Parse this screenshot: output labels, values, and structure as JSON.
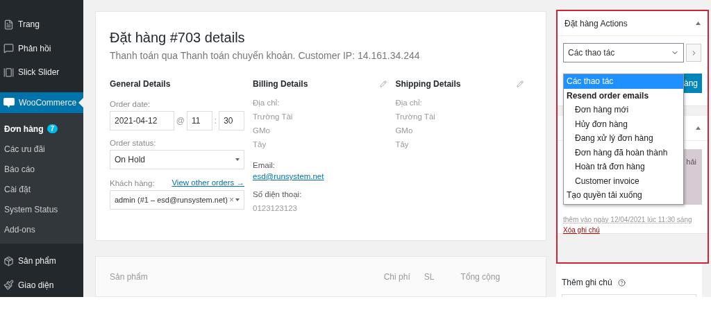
{
  "sidebar": {
    "items": [
      {
        "label": "Trang",
        "selected": false
      },
      {
        "label": "Phản hồi",
        "selected": false
      },
      {
        "label": "Slick Slider",
        "selected": false
      },
      {
        "label": "WooCommerce",
        "selected": true,
        "children": [
          {
            "label": "Đơn hàng",
            "selected": true,
            "badge": "7"
          },
          {
            "label": "Các ưu đãi",
            "selected": false
          },
          {
            "label": "Báo cáo",
            "selected": false
          },
          {
            "label": "Cài đặt",
            "selected": false
          },
          {
            "label": "System Status",
            "selected": false
          },
          {
            "label": "Add-ons",
            "selected": false
          }
        ]
      },
      {
        "label": "Sản phẩm",
        "selected": false
      },
      {
        "label": "Giao diện",
        "selected": false
      }
    ]
  },
  "order": {
    "title": "Đặt hàng #703 details",
    "subtitle": "Thanh toán qua Thanh toán chuyển khoản. Customer IP: 14.161.34.244",
    "general": {
      "heading": "General Details",
      "date_label": "Order date:",
      "date": "2021-04-12",
      "at": "@",
      "hour": "11",
      "colon": ":",
      "minute": "30",
      "status_label": "Order status:",
      "status": "On Hold",
      "customer_label": "Khách hàng:",
      "other_orders": "View other orders →",
      "customer": "admin (#1 – esd@runsystem.net)",
      "clear": "×"
    },
    "billing": {
      "heading": "Billing Details",
      "address_label": "Địa chỉ:",
      "address": [
        "Trường Tài",
        "GMo",
        "Tây"
      ],
      "email_label": "Email:",
      "email": "esd@runsystem.net",
      "phone_label": "Số điện thoại:",
      "phone": "0123123123"
    },
    "shipping": {
      "heading": "Shipping Details",
      "address_label": "Địa chỉ:",
      "address": [
        "Trường Tài",
        "GMo",
        "Tây"
      ]
    }
  },
  "items_table": {
    "columns": [
      "Sản phẩm",
      "Chi phí",
      "SL",
      "Tổng cộng"
    ]
  },
  "actions": {
    "title": "Đặt hàng Actions",
    "select": "Các thao tác",
    "button": "àng",
    "dropdown": [
      {
        "kind": "option",
        "label": "Các thao tác",
        "selected": true
      },
      {
        "kind": "group",
        "label": "Resend order emails",
        "children": [
          {
            "label": "Đơn hàng mới",
            "selected": false
          },
          {
            "label": "Hủy đơn hàng",
            "selected": false
          },
          {
            "label": "Đang xử lý đơn hàng",
            "selected": false
          },
          {
            "label": "Đơn hàng đã hoàn thành",
            "selected": false
          },
          {
            "label": "Hoàn trả đơn hàng",
            "selected": false
          },
          {
            "label": "Customer invoice",
            "selected": false
          }
        ]
      },
      {
        "kind": "option",
        "label": "Tạo quyền tải xuống",
        "selected": false
      }
    ]
  },
  "notes": {
    "note_text": "hải",
    "meta": "thêm vào ngày 12/04/2021 lúc 11:30 sáng",
    "delete": "Xóa ghi chú",
    "add_label": "Thêm ghi chú"
  }
}
